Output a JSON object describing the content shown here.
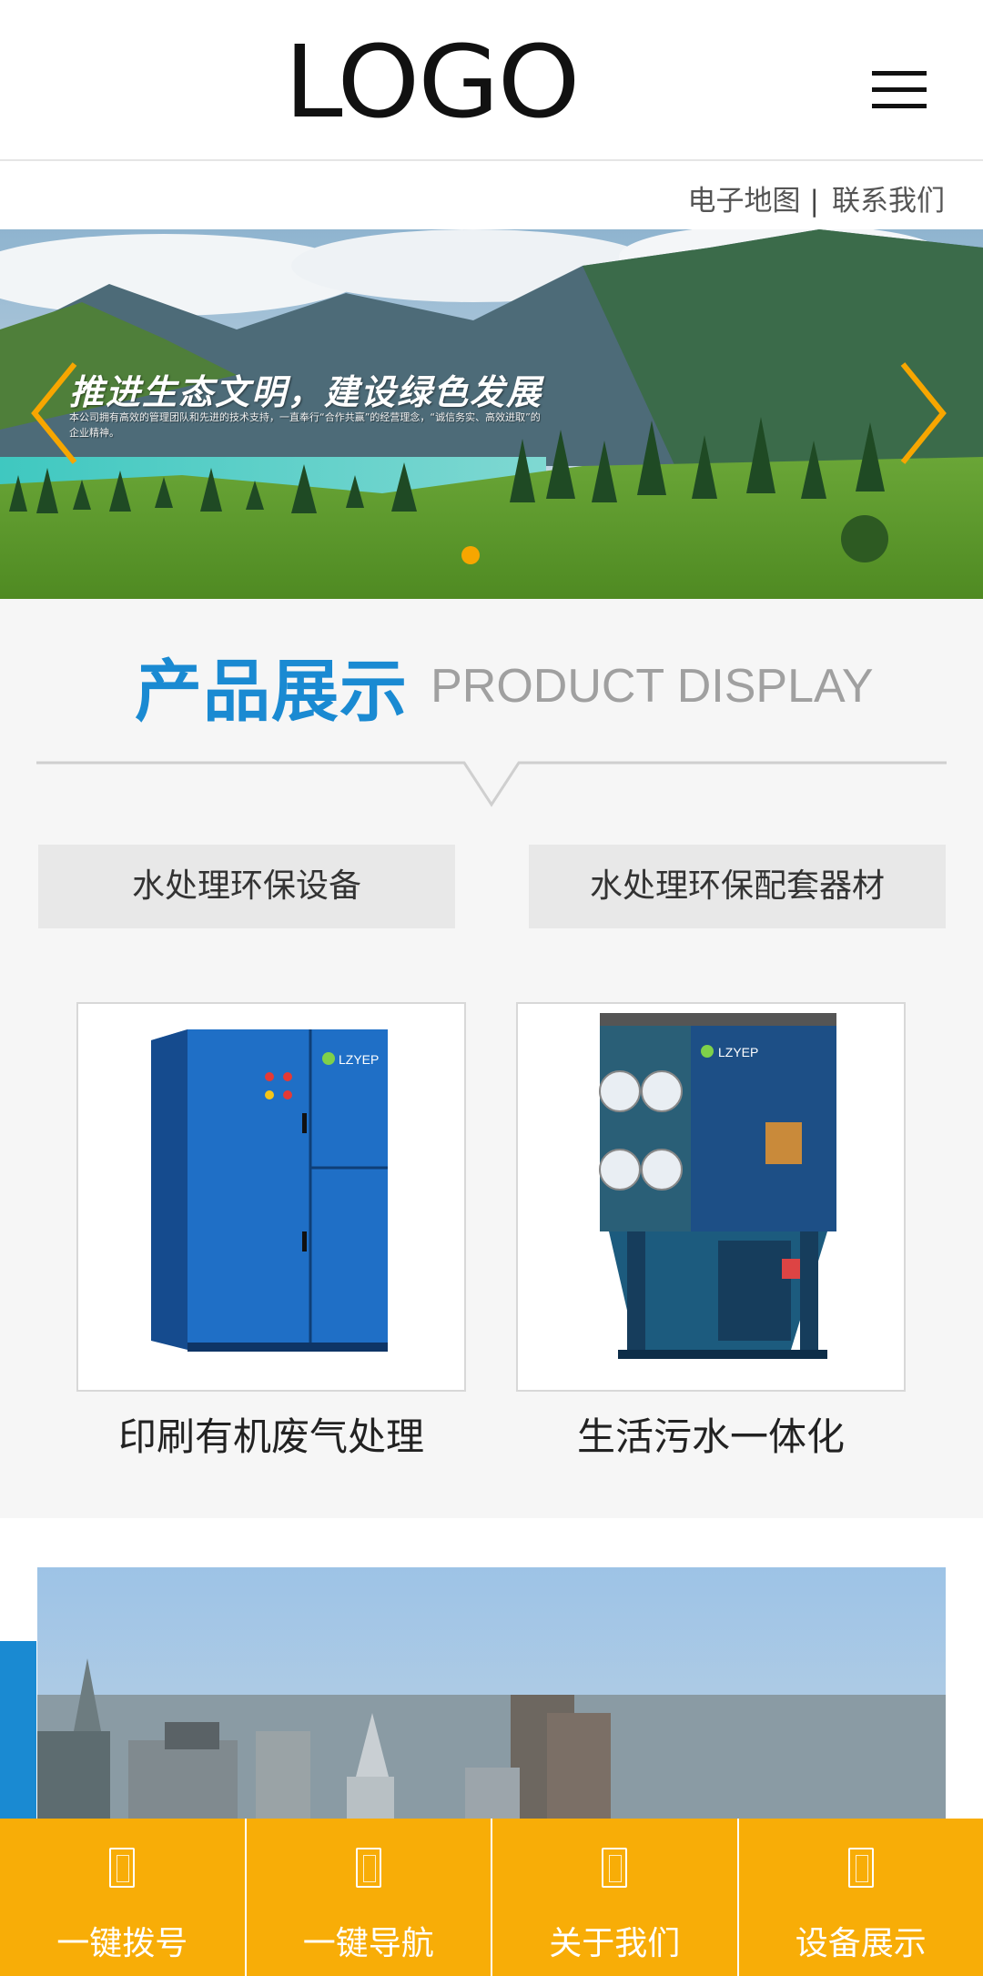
{
  "header": {
    "logo_text": "LOGO"
  },
  "toplinks": {
    "map_label": "电子地图",
    "separator": "|",
    "contact_label": "联系我们"
  },
  "banner": {
    "title": "推进生态文明，建设绿色发展",
    "subtitle": "本公司拥有高效的管理团队和先进的技术支持，一直奉行“合作共赢”的经营理念，“诚信务实、高效进取”的企业精神。",
    "active_dot_color": "#f7a600",
    "arrow_color": "#f7a600"
  },
  "products": {
    "title_cn": "产品展示",
    "title_en": "PRODUCT DISPLAY",
    "categories": [
      "水处理环保设备",
      "水处理环保配套器材"
    ],
    "items": [
      {
        "name": "印刷有机废气处理",
        "brand": "LZYEP"
      },
      {
        "name": "生活污水一体化",
        "brand": "LZYEP"
      }
    ]
  },
  "bottom_nav": {
    "items": [
      {
        "label": "一键拨号",
        "icon": "phone-icon"
      },
      {
        "label": "一键导航",
        "icon": "navigation-icon"
      },
      {
        "label": "关于我们",
        "icon": "about-icon"
      },
      {
        "label": "设备展示",
        "icon": "equipment-icon"
      }
    ]
  },
  "colors": {
    "accent_blue": "#1a8ad2",
    "accent_orange": "#f8ad07"
  }
}
